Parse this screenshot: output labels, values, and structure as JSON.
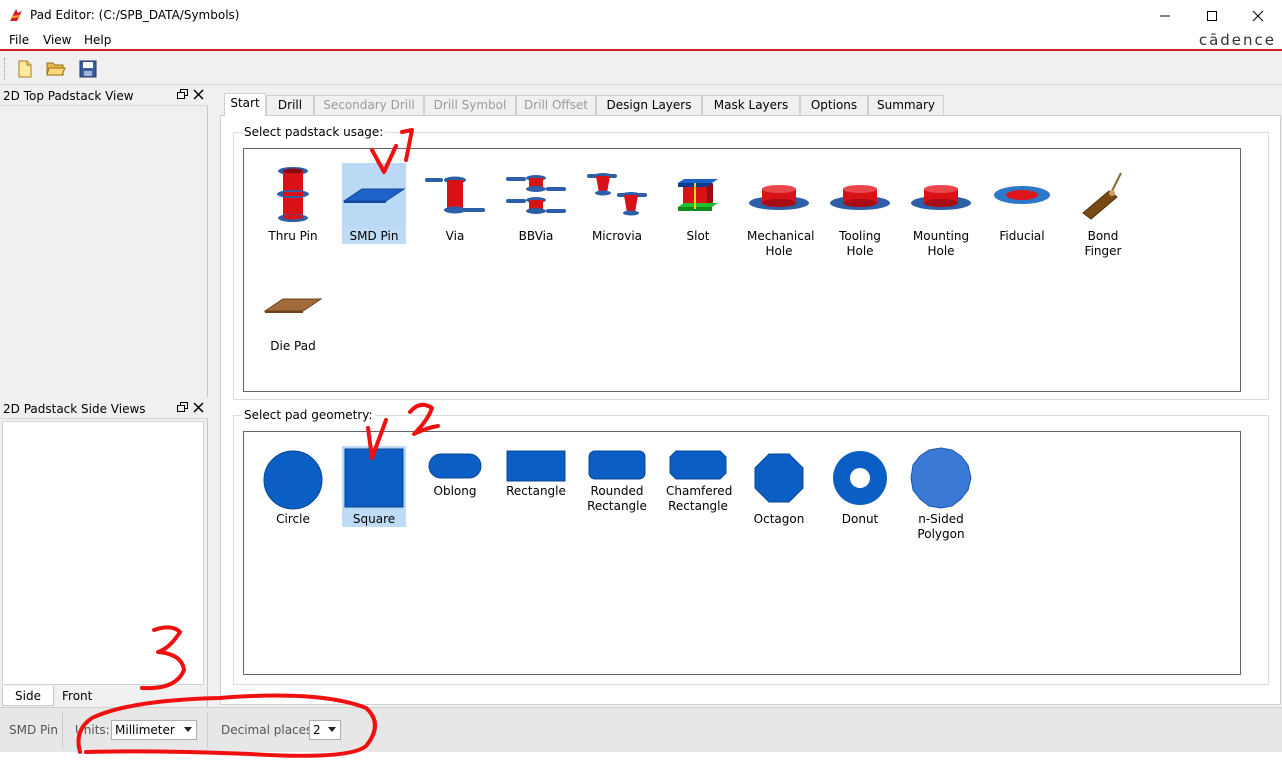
{
  "window": {
    "title": "Pad Editor:  (C:/SPB_DATA/Symbols)",
    "brand": "cādence"
  },
  "menu": [
    "File",
    "View",
    "Help"
  ],
  "toolbar": [
    "new-file-icon",
    "open-folder-icon",
    "save-icon"
  ],
  "docks": {
    "top": {
      "title": "2D Top Padstack View"
    },
    "side": {
      "title": "2D Padstack Side Views",
      "tabs": [
        "Side",
        "Front"
      ],
      "active_tab": "Side"
    }
  },
  "tabs": [
    {
      "label": "Start",
      "state": "active"
    },
    {
      "label": "Drill",
      "state": "normal"
    },
    {
      "label": "Secondary Drill",
      "state": "disabled"
    },
    {
      "label": "Drill Symbol",
      "state": "disabled"
    },
    {
      "label": "Drill Offset",
      "state": "disabled"
    },
    {
      "label": "Design Layers",
      "state": "normal"
    },
    {
      "label": "Mask Layers",
      "state": "normal"
    },
    {
      "label": "Options",
      "state": "normal"
    },
    {
      "label": "Summary",
      "state": "normal"
    }
  ],
  "usage": {
    "title": "Select padstack usage:",
    "selected": "SMD Pin",
    "items": [
      {
        "label": "Thru Pin",
        "icon": "thru-pin-icon"
      },
      {
        "label": "SMD Pin",
        "icon": "smd-pin-icon"
      },
      {
        "label": "Via",
        "icon": "via-icon"
      },
      {
        "label": "BBVia",
        "icon": "bbvia-icon"
      },
      {
        "label": "Microvia",
        "icon": "microvia-icon"
      },
      {
        "label": "Slot",
        "icon": "slot-icon"
      },
      {
        "label": "Mechanical\nHole",
        "icon": "mechanical-hole-icon"
      },
      {
        "label": "Tooling\nHole",
        "icon": "tooling-hole-icon"
      },
      {
        "label": "Mounting\nHole",
        "icon": "mounting-hole-icon"
      },
      {
        "label": "Fiducial",
        "icon": "fiducial-icon"
      },
      {
        "label": "Bond\nFinger",
        "icon": "bond-finger-icon"
      },
      {
        "label": "Die Pad",
        "icon": "die-pad-icon"
      }
    ]
  },
  "geometry": {
    "title": "Select pad geometry:",
    "selected": "Square",
    "items": [
      {
        "label": "Circle",
        "icon": "circle-pad-icon"
      },
      {
        "label": "Square",
        "icon": "square-pad-icon"
      },
      {
        "label": "Oblong",
        "icon": "oblong-pad-icon"
      },
      {
        "label": "Rectangle",
        "icon": "rectangle-pad-icon"
      },
      {
        "label": "Rounded\nRectangle",
        "icon": "rounded-rectangle-pad-icon"
      },
      {
        "label": "Chamfered\nRectangle",
        "icon": "chamfered-rectangle-pad-icon"
      },
      {
        "label": "Octagon",
        "icon": "octagon-pad-icon"
      },
      {
        "label": "Donut",
        "icon": "donut-pad-icon"
      },
      {
        "label": "n-Sided\nPolygon",
        "icon": "n-sided-polygon-pad-icon"
      }
    ]
  },
  "status": {
    "usage": "SMD Pin",
    "units_label": "Units:",
    "units_value": "Millimeter",
    "decimal_label": "Decimal places:",
    "decimal_value": "2"
  },
  "annotations": [
    "V1",
    "V2",
    "3"
  ],
  "colors": {
    "accent_red": "#d11f2a",
    "pad_blue": "#0b5fc4",
    "copper_red": "#e0151c",
    "selection": "#bfdcf6",
    "annotation": "#f01010"
  }
}
